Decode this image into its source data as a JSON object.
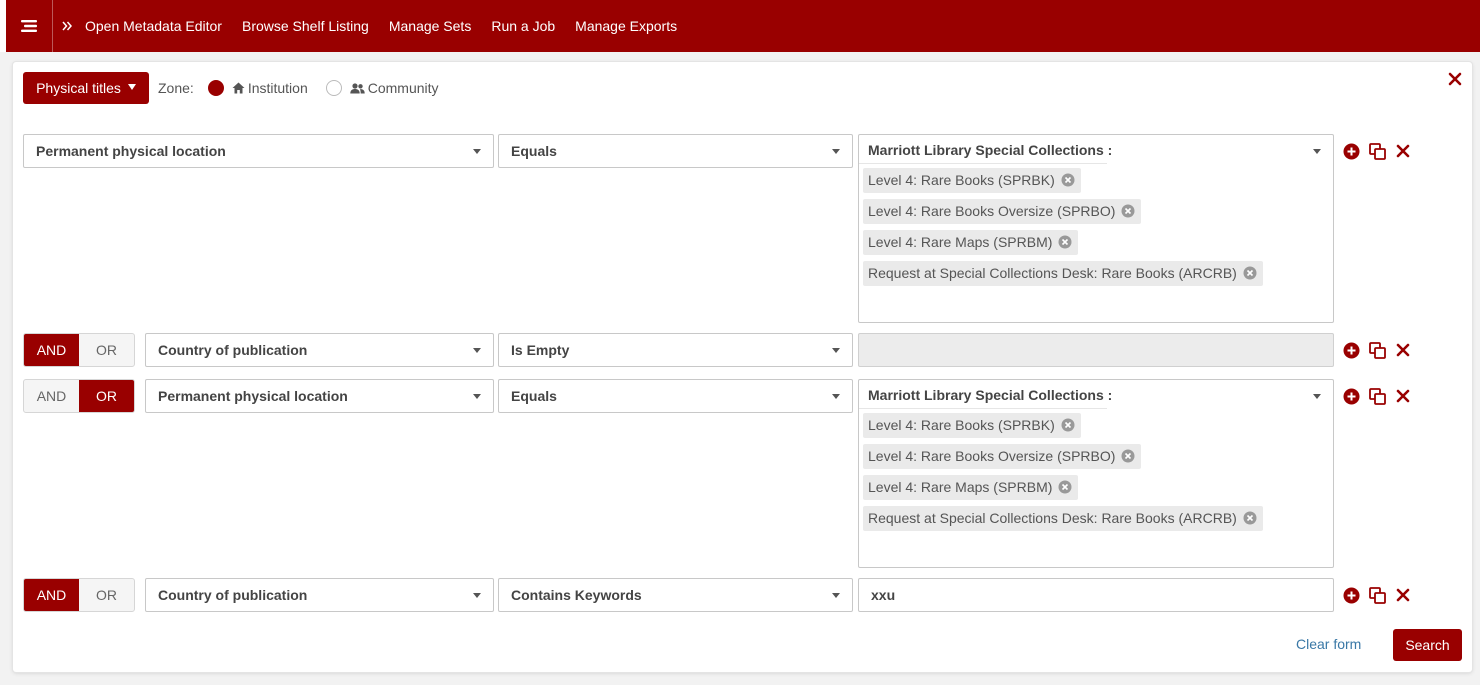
{
  "topbar": {
    "links": [
      "Open Metadata Editor",
      "Browse Shelf Listing",
      "Manage Sets",
      "Run a Job",
      "Manage Exports"
    ]
  },
  "search": {
    "type_label": "Physical titles",
    "zone_label": "Zone:",
    "zone_options": [
      "Institution",
      "Community"
    ],
    "selected_zone": "Institution"
  },
  "conditions": [
    {
      "connector": null,
      "field": "Permanent physical location",
      "operator": "Equals",
      "value_group": "Marriott Library Special Collections :",
      "values": [
        "Level 4: Rare Books (SPRBK)",
        "Level 4: Rare Books Oversize (SPRBO)",
        "Level 4: Rare Maps (SPRBM)",
        "Request at Special Collections Desk: Rare Books (ARCRB)"
      ]
    },
    {
      "connector": "AND",
      "connector_options": [
        "AND",
        "OR"
      ],
      "field": "Country of publication",
      "operator": "Is Empty",
      "value": ""
    },
    {
      "connector": "OR",
      "connector_options": [
        "AND",
        "OR"
      ],
      "field": "Permanent physical location",
      "operator": "Equals",
      "value_group": "Marriott Library Special Collections :",
      "values": [
        "Level 4: Rare Books (SPRBK)",
        "Level 4: Rare Books Oversize (SPRBO)",
        "Level 4: Rare Maps (SPRBM)",
        "Request at Special Collections Desk: Rare Books (ARCRB)"
      ]
    },
    {
      "connector": "AND",
      "connector_options": [
        "AND",
        "OR"
      ],
      "field": "Country of publication",
      "operator": "Contains Keywords",
      "value": "xxu"
    }
  ],
  "footer": {
    "clear_label": "Clear form",
    "search_label": "Search"
  },
  "colors": {
    "brand": "#990000",
    "link": "#3a78a6"
  },
  "icons": [
    "menu-icon",
    "double-chevron-right-icon",
    "home-icon",
    "users-icon",
    "close-icon",
    "add-circle-icon",
    "duplicate-icon",
    "remove-icon"
  ]
}
